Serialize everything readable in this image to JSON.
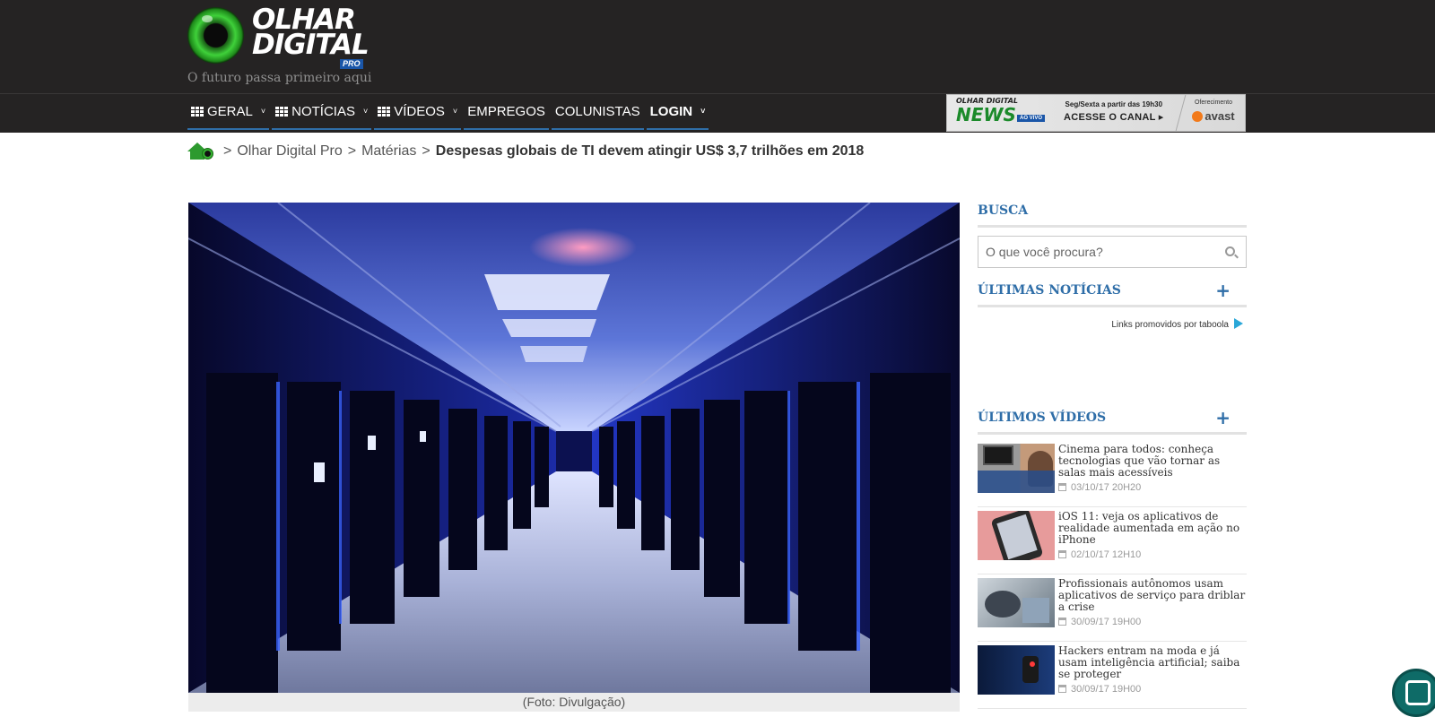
{
  "header": {
    "logo_line1": "OLHAR",
    "logo_line2": "DIGITAL",
    "logo_badge": "PRO",
    "tagline": "O futuro passa primeiro aqui"
  },
  "nav": {
    "items": [
      {
        "label": "GERAL",
        "grid_icon": true,
        "dropdown": true
      },
      {
        "label": "NOTÍCIAS",
        "grid_icon": true,
        "dropdown": true
      },
      {
        "label": "VÍDEOS",
        "grid_icon": true,
        "dropdown": true
      },
      {
        "label": "EMPREGOS",
        "grid_icon": false,
        "dropdown": false
      },
      {
        "label": "COLUNISTAS",
        "grid_icon": false,
        "dropdown": false
      },
      {
        "label": "LOGIN",
        "grid_icon": false,
        "dropdown": true
      }
    ]
  },
  "ad_banner": {
    "brand_small": "OLHAR DIGITAL",
    "brand_big": "NEWS",
    "live": "AO VIVO",
    "schedule": "Seg/Sexta a partir das 19h30",
    "cta": "ACESSE O CANAL ▸",
    "sponsor_label": "Oferecimento",
    "sponsor": "avast"
  },
  "breadcrumb": {
    "items": [
      "Olhar Digital Pro",
      "Matérias"
    ],
    "current": "Despesas globais de TI devem atingir US$ 3,7 trilhões em 2018"
  },
  "hero": {
    "caption": "(Foto: Divulgação)"
  },
  "sidebar": {
    "search_title": "BUSCA",
    "search_placeholder": "O que você procura?",
    "news_title": "ÚLTIMAS NOTÍCIAS",
    "taboola_text": "Links promovidos por taboola",
    "videos_title": "ÚLTIMOS VÍDEOS",
    "videos": [
      {
        "title": "Cinema para todos: conheça tecnologias que vão tornar as salas mais acessíveis",
        "date": "03/10/17 20H20"
      },
      {
        "title": "iOS 11: veja os aplicativos de realidade aumentada em ação no iPhone",
        "date": "02/10/17 12H10"
      },
      {
        "title": "Profissionais autônomos usam aplicativos de serviço para driblar a crise",
        "date": "30/09/17 19H00"
      },
      {
        "title": "Hackers entram na moda e já usam inteligência artificial; saiba se proteger",
        "date": "30/09/17 19H00"
      }
    ]
  },
  "colors": {
    "header_bg": "#252323",
    "accent_blue": "#2f6ea8",
    "brand_green": "#2d9a2f"
  }
}
